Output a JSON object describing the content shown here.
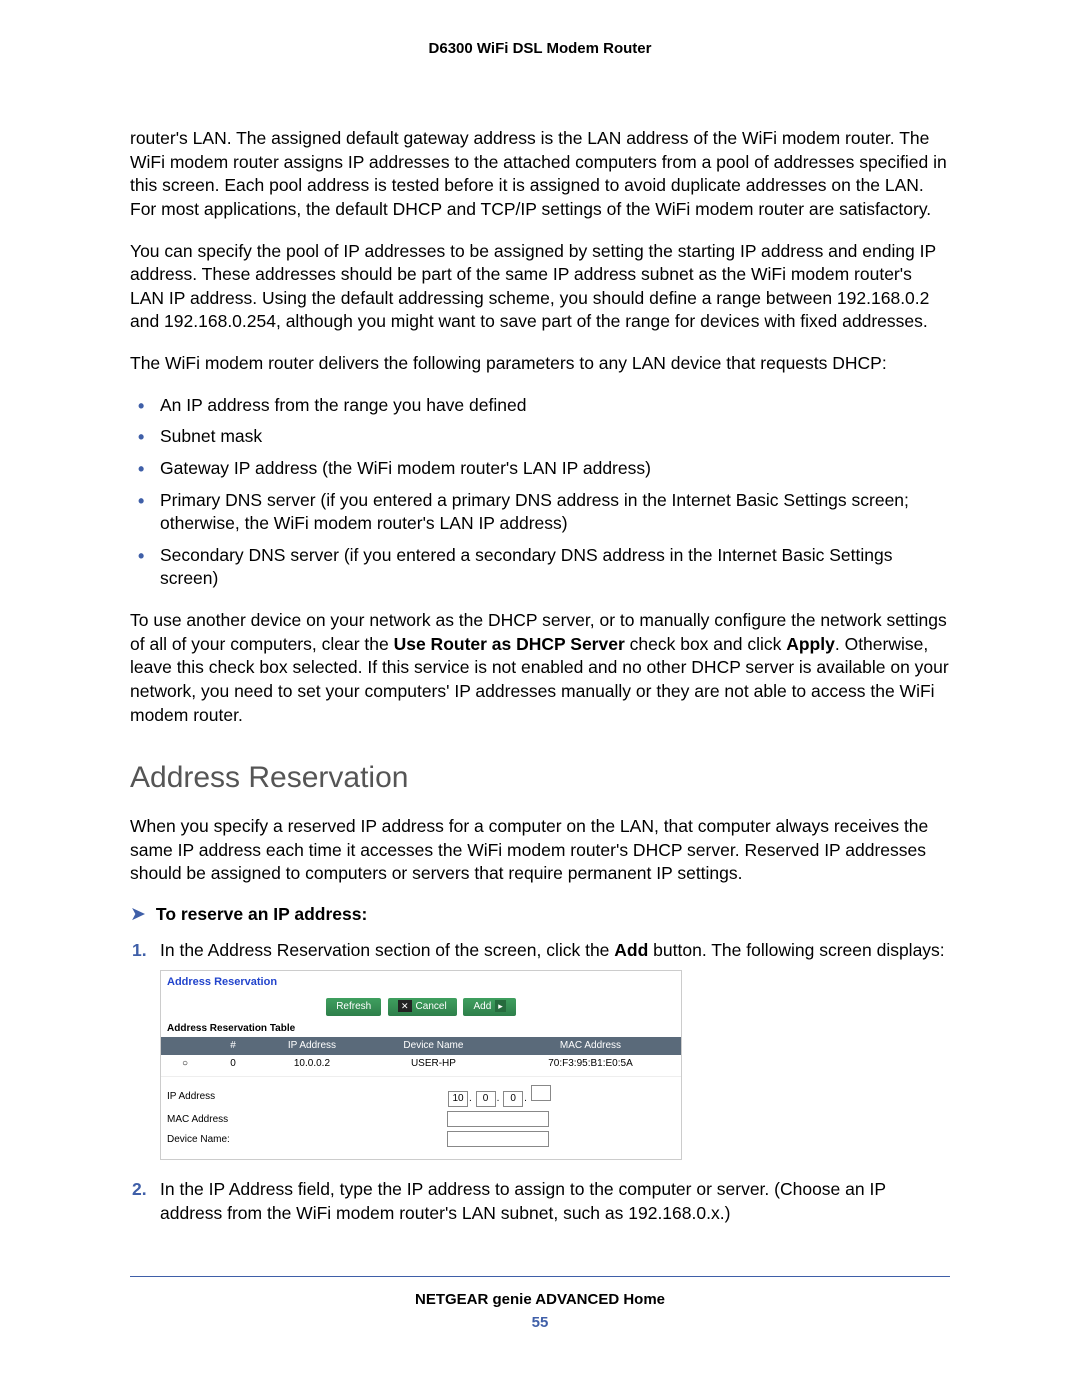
{
  "header": {
    "title": "D6300 WiFi DSL Modem Router"
  },
  "paragraphs": {
    "p1": "router's LAN. The assigned default gateway address is the LAN address of the WiFi modem router. The WiFi modem router assigns IP addresses to the attached computers from a pool of addresses specified in this screen. Each pool address is tested before it is assigned to avoid duplicate addresses on the LAN. For most applications, the default DHCP and TCP/IP settings of the WiFi modem router are satisfactory.",
    "p2": "You can specify the pool of IP addresses to be assigned by setting the starting IP address and ending IP address. These addresses should be part of the same IP address subnet as the WiFi modem router's LAN IP address. Using the default addressing scheme, you should define a range between 192.168.0.2 and 192.168.0.254, although you might want to save part of the range for devices with fixed addresses.",
    "p3": "The WiFi modem router delivers the following parameters to any LAN device that requests DHCP:",
    "p4_pre": "To use another device on your network as the DHCP server, or to manually configure the network settings of all of your computers, clear the ",
    "p4_bold1": "Use Router as DHCP Server",
    "p4_mid": " check box and click ",
    "p4_bold2": "Apply",
    "p4_post": ". Otherwise, leave this check box selected. If this service is not enabled and no other DHCP server is available on your network, you need to set your computers' IP addresses manually or they are not able to access the WiFi modem router.",
    "addr_res_intro": "When you specify a reserved IP address for a computer on the LAN, that computer always receives the same IP address each time it accesses the WiFi modem router's DHCP server. Reserved IP addresses should be assigned to computers or servers that require permanent IP settings."
  },
  "bullets": {
    "b1": "An IP address from the range you have defined",
    "b2": "Subnet mask",
    "b3": "Gateway IP address (the WiFi modem router's LAN IP address)",
    "b4": "Primary DNS server (if you entered a primary DNS address in the Internet Basic Settings screen; otherwise, the WiFi modem router's LAN IP address)",
    "b5": "Secondary DNS server (if you entered a secondary DNS address in the Internet Basic Settings screen)"
  },
  "section_heading": "Address Reservation",
  "procedure_lead": "To reserve an IP address:",
  "steps": {
    "s1_pre": "In the Address Reservation section of the screen, click the ",
    "s1_bold": "Add",
    "s1_post": " button. The following screen displays:",
    "s2": "In the IP Address field, type the IP address to assign to the computer or server. (Choose an IP address from the WiFi modem router's LAN subnet, such as 192.168.0.x.)"
  },
  "screenshot": {
    "title": "Address Reservation",
    "buttons": {
      "refresh": "Refresh",
      "cancel": "Cancel",
      "add": "Add"
    },
    "table_label": "Address Reservation Table",
    "headers": {
      "num": "#",
      "ip": "IP Address",
      "device": "Device Name",
      "mac": "MAC Address"
    },
    "row": {
      "radio": "○",
      "num": "0",
      "ip": "10.0.0.2",
      "device": "USER-HP",
      "mac": "70:F3:95:B1:E0:5A"
    },
    "form": {
      "ip_label": "IP Address",
      "ip_oct1": "10",
      "ip_oct2": "0",
      "ip_oct3": "0",
      "ip_oct4": "",
      "mac_label": "MAC Address",
      "device_label": "Device Name:"
    }
  },
  "footer": {
    "title": "NETGEAR genie ADVANCED Home",
    "page": "55"
  }
}
